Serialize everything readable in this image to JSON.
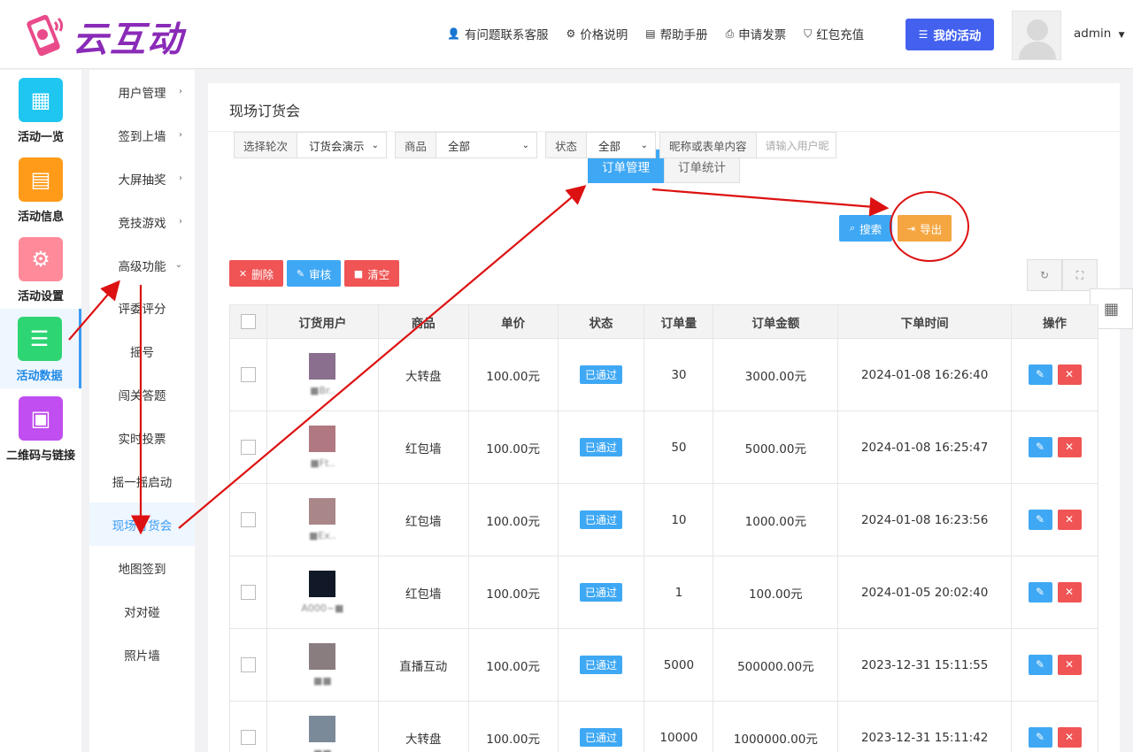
{
  "header": {
    "logo_text": "云互动",
    "nav": [
      {
        "icon": "user-plus-icon",
        "glyph": "👤",
        "label": "有问题联系客服"
      },
      {
        "icon": "gear-icon",
        "glyph": "⚙",
        "label": "价格说明"
      },
      {
        "icon": "book-icon",
        "glyph": "▤",
        "label": "帮助手册"
      },
      {
        "icon": "printer-icon",
        "glyph": "⎙",
        "label": "申请发票"
      },
      {
        "icon": "shield-check-icon",
        "glyph": "⛉",
        "label": "红包充值"
      }
    ],
    "my_activity": "我的活动",
    "username": "admin"
  },
  "rail": [
    {
      "label": "活动一览",
      "icon": "grid-icon",
      "color": "#1ec6f0",
      "glyph": "▦"
    },
    {
      "label": "活动信息",
      "icon": "document-icon",
      "color": "#ff9b18",
      "glyph": "▤"
    },
    {
      "label": "活动设置",
      "icon": "gear-icon",
      "color": "#ff8a9a",
      "glyph": "⚙"
    },
    {
      "label": "活动数据",
      "icon": "database-icon",
      "color": "#2ed573",
      "glyph": "☰"
    },
    {
      "label": "二维码与链接",
      "icon": "qrcode-icon",
      "color": "#c04ef0",
      "glyph": "▣"
    }
  ],
  "submenu": {
    "top_items": [
      "用户管理",
      "签到上墙",
      "大屏抽奖",
      "竞技游戏",
      "高级功能"
    ],
    "sub_items": [
      "评委评分",
      "摇号",
      "闯关答题",
      "实时投票",
      "摇一摇启动",
      "现场订货会",
      "地图签到",
      "对对碰",
      "照片墙"
    ],
    "active": "现场订货会"
  },
  "page": {
    "title": "现场订货会",
    "tabs": [
      "订单管理",
      "订单统计"
    ],
    "filters": {
      "round_label": "选择轮次",
      "round_value": "订货会演示",
      "product_label": "商品",
      "product_value": "全部",
      "status_label": "状态",
      "status_value": "全部",
      "search_label": "昵称或表单内容",
      "search_placeholder": "请输入用户昵"
    },
    "buttons": {
      "search": "搜索",
      "export": "导出",
      "delete": "删除",
      "review": "审核",
      "clear": "清空"
    }
  },
  "table": {
    "headers": [
      "",
      "订货用户",
      "商品",
      "单价",
      "状态",
      "订单量",
      "订单金额",
      "下单时间",
      "操作"
    ],
    "rows": [
      {
        "user": "■Br..",
        "product": "大转盘",
        "price": "100.00元",
        "status": "已通过",
        "qty": "30",
        "amount": "3000.00元",
        "time": "2024-01-08 16:26:40",
        "avatar_color": "#8a6f8e"
      },
      {
        "user": "■Ft..",
        "product": "红包墙",
        "price": "100.00元",
        "status": "已通过",
        "qty": "50",
        "amount": "5000.00元",
        "time": "2024-01-08 16:25:47",
        "avatar_color": "#b07880"
      },
      {
        "user": "■Ex..",
        "product": "红包墙",
        "price": "100.00元",
        "status": "已通过",
        "qty": "10",
        "amount": "1000.00元",
        "time": "2024-01-08 16:23:56",
        "avatar_color": "#a98789"
      },
      {
        "user": "A000~■",
        "product": "红包墙",
        "price": "100.00元",
        "status": "已通过",
        "qty": "1",
        "amount": "100.00元",
        "time": "2024-01-05 20:02:40",
        "avatar_color": "#111827"
      },
      {
        "user": "■■",
        "product": "直播互动",
        "price": "100.00元",
        "status": "已通过",
        "qty": "5000",
        "amount": "500000.00元",
        "time": "2023-12-31 15:11:55",
        "avatar_color": "#8a7d80"
      },
      {
        "user": "■■",
        "product": "大转盘",
        "price": "100.00元",
        "status": "已通过",
        "qty": "10000",
        "amount": "1000000.00元",
        "time": "2023-12-31 15:11:42",
        "avatar_color": "#7b8a99"
      }
    ]
  }
}
